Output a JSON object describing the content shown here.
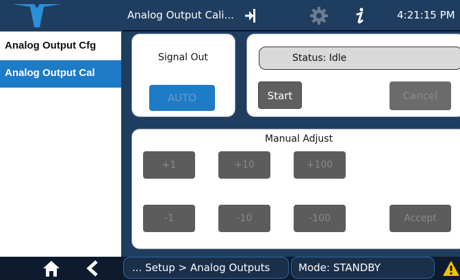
{
  "header": {
    "title": "Analog Output Cali...",
    "clock": "4:21:15 PM",
    "icons": [
      "logout-icon",
      "gear-icon",
      "info-icon"
    ]
  },
  "sidebar": {
    "items": [
      {
        "label": "Analog Output Cfg",
        "selected": false
      },
      {
        "label": "Analog Output Cal",
        "selected": true
      }
    ]
  },
  "signal_panel": {
    "label": "Signal Out",
    "button": "AUTO"
  },
  "status_panel": {
    "status_text": "Status:  Idle",
    "start_label": "Start",
    "cancel_label": "Cancel"
  },
  "manual_panel": {
    "label": "Manual Adjust",
    "plus": [
      "+1",
      "+10",
      "+100"
    ],
    "minus": [
      "-1",
      "-10",
      "-100"
    ],
    "accept_label": "Accept"
  },
  "footer": {
    "breadcrumb": "... Setup > Analog Outputs",
    "mode": "Mode: STANDBY",
    "icons": [
      "home-icon",
      "back-icon",
      "warning-icon"
    ]
  },
  "colors": {
    "header_bg": "#1f3d5f",
    "selected_blue": "#1e7bc6",
    "disabled_button": "#5c5c5c",
    "warning": "#f2c200"
  }
}
